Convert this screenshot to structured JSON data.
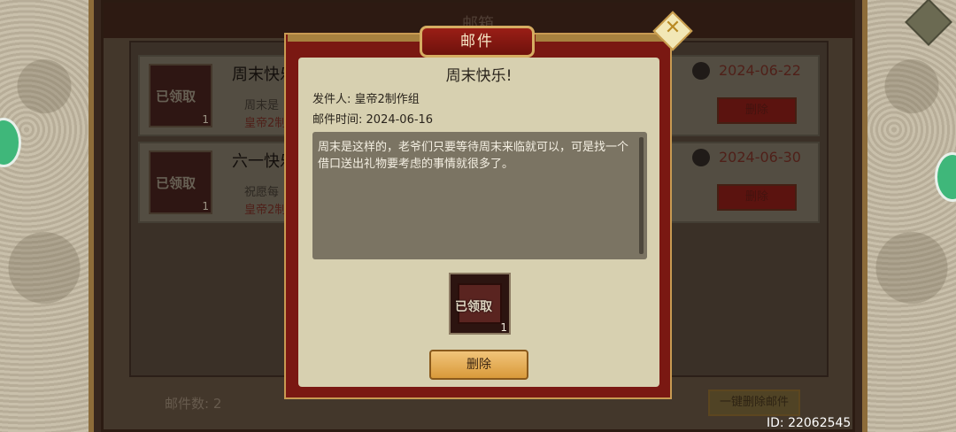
{
  "background": {
    "title": "邮箱",
    "mails": [
      {
        "title": "周末快乐",
        "preview": "周末是",
        "sender": "皇帝2制",
        "date": "2024-06-22",
        "stamp": "已领取",
        "count": "1",
        "delete_label": "删除"
      },
      {
        "title": "六一快乐",
        "preview": "祝愿每",
        "sender": "皇帝2制",
        "date": "2024-06-30",
        "stamp": "已领取",
        "count": "1",
        "delete_label": "删除"
      }
    ],
    "mail_count_label": "邮件数:",
    "mail_count_value": "2",
    "one_click_delete_label": "一键删除邮件"
  },
  "modal": {
    "tab_label": "邮件",
    "title": "周末快乐!",
    "sender_label": "发件人:",
    "sender_value": "皇帝2制作组",
    "time_label": "邮件时间:",
    "time_value": "2024-06-16",
    "body": "周末是这样的，老爷们只要等待周末来临就可以，可是找一个借口送出礼物要考虑的事情就很多了。",
    "item": {
      "stamp": "已领取",
      "count": "1"
    },
    "delete_label": "删除",
    "close_icon": "close-x-icon"
  },
  "footer": {
    "id_text": "ID: 22062545"
  },
  "colors": {
    "modal_frame": "#7a1812",
    "modal_inner": "#d7d0b0",
    "accent_red": "#6a2b22",
    "gold": "#c89a52"
  }
}
